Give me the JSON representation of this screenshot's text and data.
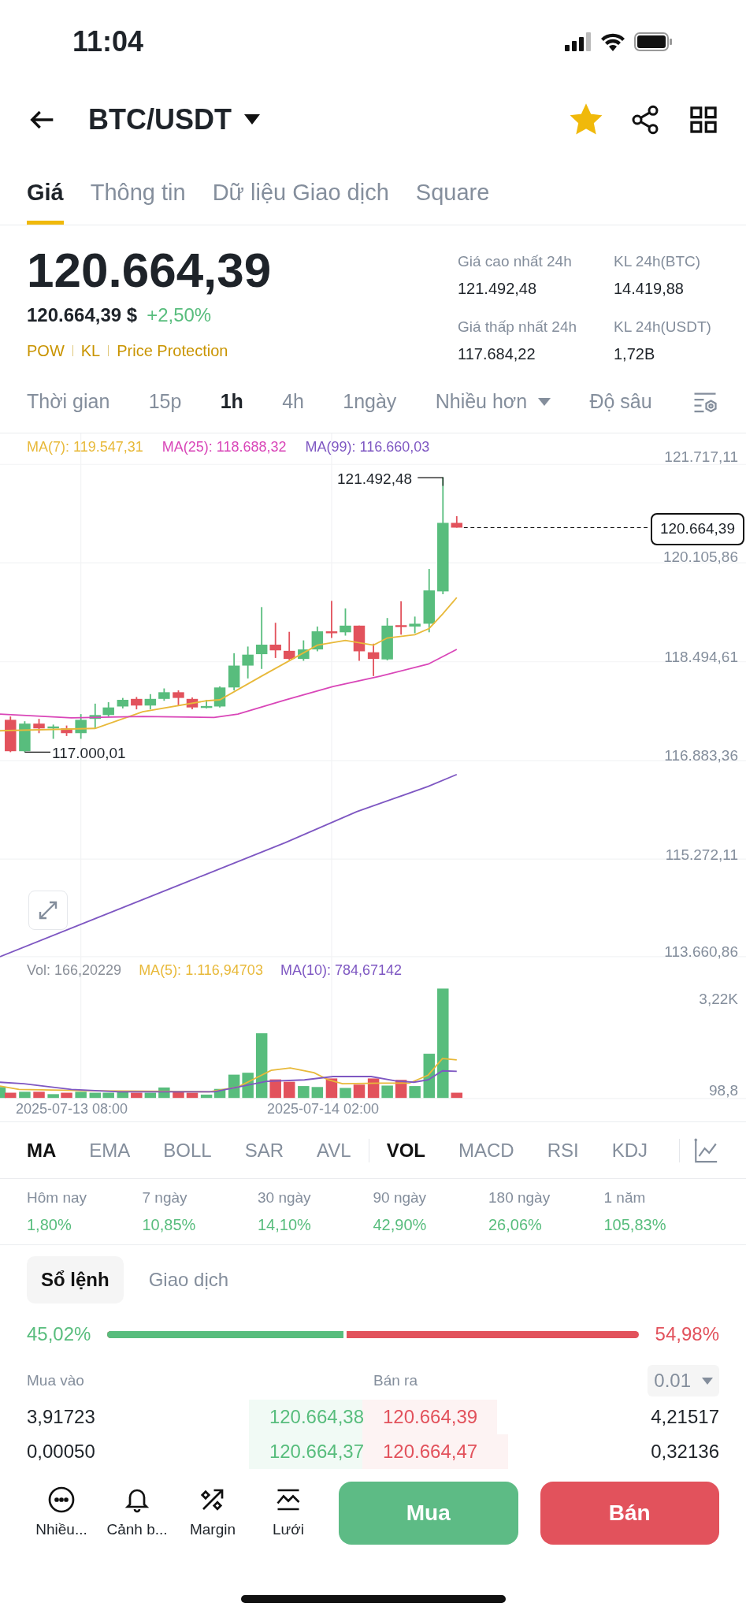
{
  "status_bar": {
    "time": "11:04"
  },
  "header": {
    "pair": "BTC/USDT",
    "favorite": true
  },
  "tabs": [
    {
      "label": "Giá",
      "selected": true
    },
    {
      "label": "Thông tin",
      "selected": false
    },
    {
      "label": "Dữ liệu Giao dịch",
      "selected": false
    },
    {
      "label": "Square",
      "selected": false
    }
  ],
  "ticker": {
    "price": "120.664,39",
    "fiat_price": "120.664,39 $",
    "change": "+2,50%",
    "tags": [
      "POW",
      "KL",
      "Price Protection"
    ]
  },
  "stats": [
    {
      "label": "Giá cao nhất 24h",
      "value": "121.492,48"
    },
    {
      "label": "KL 24h(BTC)",
      "value": "14.419,88"
    },
    {
      "label": "Giá thấp nhất 24h",
      "value": "117.684,22"
    },
    {
      "label": "KL 24h(USDT)",
      "value": "1,72B"
    }
  ],
  "intervals": [
    {
      "label": "Thời gian",
      "kind": "option",
      "selected": false
    },
    {
      "label": "15p",
      "kind": "option",
      "selected": false
    },
    {
      "label": "1h",
      "kind": "option",
      "selected": true
    },
    {
      "label": "4h",
      "kind": "option",
      "selected": false
    },
    {
      "label": "1ngày",
      "kind": "option",
      "selected": false
    },
    {
      "label": "Nhiều hơn",
      "kind": "dropdown",
      "selected": false
    },
    {
      "label": "Độ sâu",
      "kind": "option",
      "selected": false
    }
  ],
  "chart": {
    "ma_legend": [
      {
        "label": "MA(7): 119.547,31",
        "color": "#e8b93a"
      },
      {
        "label": "MA(25): 118.688,32",
        "color": "#d946b8"
      },
      {
        "label": "MA(99): 116.660,03",
        "color": "#7e57c2"
      }
    ],
    "y_ticks": [
      "121.717,11",
      "120.105,86",
      "118.494,61",
      "116.883,36",
      "115.272,11",
      "113.660,86"
    ],
    "high_label": "121.492,48",
    "low_label": "117.000,01",
    "last_price": "120.664,39"
  },
  "volume": {
    "legend": [
      {
        "label": "Vol: 166,20229",
        "color": "#8a8f98"
      },
      {
        "label": "MA(5): 1.116,94703",
        "color": "#e8b93a"
      },
      {
        "label": "MA(10): 784,67142",
        "color": "#7e57c2"
      }
    ],
    "y_ticks": [
      "3,22K",
      "98,8"
    ],
    "x_labels": [
      "2025-07-13 08:00",
      "2025-07-14 02:00"
    ]
  },
  "main_indicators": [
    {
      "label": "MA",
      "selected": true
    },
    {
      "label": "EMA",
      "selected": false
    },
    {
      "label": "BOLL",
      "selected": false
    },
    {
      "label": "SAR",
      "selected": false
    },
    {
      "label": "AVL",
      "selected": false
    }
  ],
  "sub_indicators": [
    {
      "label": "VOL",
      "selected": true
    },
    {
      "label": "MACD",
      "selected": false
    },
    {
      "label": "RSI",
      "selected": false
    },
    {
      "label": "KDJ",
      "selected": false
    }
  ],
  "performance": [
    {
      "period": "Hôm nay",
      "value": "1,80%"
    },
    {
      "period": "7 ngày",
      "value": "10,85%"
    },
    {
      "period": "30 ngày",
      "value": "14,10%"
    },
    {
      "period": "90 ngày",
      "value": "42,90%"
    },
    {
      "period": "180 ngày",
      "value": "26,06%"
    },
    {
      "period": "1 năm",
      "value": "105,83%"
    }
  ],
  "order_book": {
    "tabs": [
      {
        "label": "Sổ lệnh",
        "selected": true
      },
      {
        "label": "Giao dịch",
        "selected": false
      }
    ],
    "buy_ratio": {
      "label": "45,02%",
      "level": 0.4502
    },
    "sell_ratio": "54,98%",
    "bid_header": "Mua vào",
    "ask_header": "Bán ra",
    "precision": "0.01",
    "rows": [
      {
        "bid": {
          "amount": "3,91723",
          "price": "120.664,38"
        },
        "ask": {
          "price": "120.664,39",
          "amount": "4,21517"
        }
      },
      {
        "bid": {
          "amount": "0,00050",
          "price": "120.664,37"
        },
        "ask": {
          "price": "120.664,47",
          "amount": "0,32136"
        }
      }
    ]
  },
  "bottom_bar": {
    "actions": [
      "Nhiều...",
      "Cảnh b...",
      "Margin",
      "Lưới"
    ],
    "buy": "Mua",
    "sell": "Bán"
  }
}
